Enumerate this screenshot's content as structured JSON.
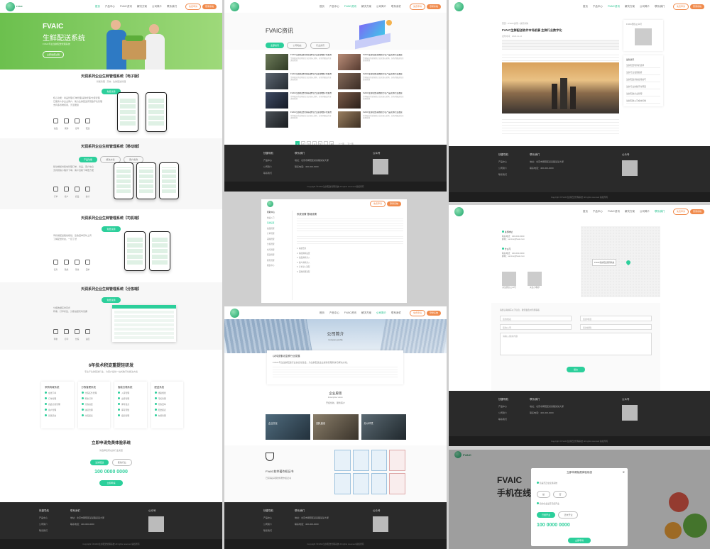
{
  "nav": {
    "brand": "FVAIC",
    "brand_sub": "生鲜配送",
    "links": [
      "首页",
      "产品中心",
      "FVAIC资讯",
      "解决方案",
      "公司简介",
      "联系我们"
    ],
    "apply": "免费申请",
    "login": "登录系统"
  },
  "p1": {
    "hero_title": "FVAIC",
    "hero_sub": "生鲜配送系统",
    "hero_desc": "FVAIC专业生鲜配送管理系统",
    "hero_btn": "立即免费试用",
    "sec1_title": "天润系列企业生鲜管理系统【电子版】",
    "sec1_sub": "智能管理 · 高效 · 生鲜配送管理",
    "sec1_btn": "免费试用",
    "sec1_text": [
      "核心功能：商品管理/订单管理/采购管理/分拣管理",
      "已服务众多企业客户，助力生鲜配送实现数字化管理",
      "支持多终端使用，灵活便捷"
    ],
    "sec1_icons": [
      "商品",
      "采购",
      "仓库",
      "配送"
    ],
    "sec2_title": "天润系列企业生鲜管理系统【移动端】",
    "sec2_tabs": [
      "产品功能",
      "解决方案",
      "客户案例"
    ],
    "sec2_text": [
      "移动端随时随地管理订单、商品、客户信息",
      "支持微信小程序下单，客户自助下单更方便"
    ],
    "sec2_icons": [
      "订单",
      "客户",
      "商品",
      "统计"
    ],
    "sec3_title": "天润系列企业生鲜管理系统【司机端】",
    "sec3_btn": "免费试用",
    "sec3_text": [
      "司机端配送路线规划，签收回单实时上传",
      "了解配送状态，一目了然"
    ],
    "sec3_icons": [
      "任务",
      "路线",
      "签收",
      "回单"
    ],
    "sec4_title": "天润系列企业生鲜管理系统【分拣端】",
    "sec4_btn": "免费试用",
    "sec4_text": [
      "分拣数据实时同步",
      "称重、打印标签、分拣进度实时掌握"
    ],
    "sec4_icons": [
      "称重",
      "打印",
      "分拣",
      "进度"
    ],
    "feature_title": "6年技术积淀重提轻研发",
    "feature_sub": "专注于生鲜配送行业，为客户提供一站式数字化解决方案",
    "feature_cards": [
      {
        "title": "采购商城系统",
        "items": [
          "在线下单",
          "订单管理",
          "商品分类管理",
          "客户管理",
          "营销活动"
        ]
      },
      {
        "title": "分拣管理系统",
        "items": [
          "分拣任务管理",
          "称重打印",
          "分拣进度",
          "缺货管理",
          "分拣报表"
        ]
      },
      {
        "title": "智能仓储系统",
        "items": [
          "入库管理",
          "出库管理",
          "库存盘点",
          "库存预警",
          "报损管理"
        ]
      },
      {
        "title": "配送系统",
        "items": [
          "线路规划",
          "司机管理",
          "签收回单",
          "配送报表",
          "车辆管理"
        ]
      }
    ],
    "apply_title": "立即申请免费体验系统",
    "apply_hint": "请选择您所在的行业类型",
    "apply_opts": [
      "生鲜配送",
      "其他行业"
    ],
    "phone": "100 0000 0000",
    "apply_btn": "立即申请"
  },
  "p2": {
    "title": "FVAIC资讯",
    "tabs": [
      "全部资讯",
      "公司动态",
      "行业资讯"
    ],
    "news": [
      "FVAIC生鲜配送管理系统为企业提供数字化服务",
      "FVAIC生鲜配送系统助力农产品流通行业发展",
      "FVAIC生鲜配送管理系统为企业提供数字化服务",
      "FVAIC生鲜配送系统助力农产品流通行业发展",
      "FVAIC生鲜配送管理系统为企业提供数字化服务",
      "FVAIC生鲜配送系统助力农产品流通行业发展",
      "FVAIC生鲜配送管理系统为企业提供数字化服务",
      "FVAIC生鲜配送系统助力农产品流通行业发展"
    ],
    "news_desc": "生鲜配送系统帮助企业实现从采购、分拣到配送的全流程管理",
    "pages": [
      "1",
      "2",
      "3",
      "4",
      "5",
      "...",
      "10"
    ],
    "prev": "上一页",
    "next": "下一页"
  },
  "p3": {
    "breadcrumb": [
      "首页",
      "FVAIC资讯",
      "资讯详情"
    ],
    "title": "FVAIC生鲜配送软件市场前景 生鲜行业数字化",
    "meta": "发布时间：2020-11-12",
    "side_title": "FVAIC微信公众号",
    "hot_title": "最新资讯",
    "hot": [
      "生鲜配送软件的选择",
      "生鲜行业发展趋势",
      "生鲜配送系统使用技巧",
      "生鲜行业的数字化转型",
      "生鲜配送企业管理",
      "生鲜配送公司成本控制"
    ]
  },
  "p4": {
    "menu_title": "帮助中心",
    "menu": [
      "快速入门",
      "基础设置",
      "商品管理",
      "订单管理",
      "采购管理",
      "分拣管理",
      "仓库管理",
      "配送管理",
      "财务管理",
      "报表中心"
    ],
    "title": "系统设置 基础设置",
    "steps": [
      "1. 系统登录",
      "2. 基础资料设置",
      "3. 商品资料录入",
      "4. 客户资料录入",
      "5. 订单录入流程",
      "6. 采购管理流程"
    ]
  },
  "p5": {
    "banner_title": "公司简介",
    "banner_sub": "Company profile",
    "card_title": "以科技推动生鲜行业发展",
    "card_text": "FVAIC专注生鲜配送行业信息化建设，为生鲜配送企业提供管理系统与解决方案。",
    "culture_title": "企业愿景",
    "culture_sub": "Enterprise vision",
    "culture_text": "开拓创新，服务客户",
    "photo_labels": [
      "企业文化",
      "团队建设",
      "办公环境"
    ],
    "cert_title": "FVAIC软件著作权证书",
    "cert_text": "已获得多项软件著作权证书"
  },
  "p6": {
    "contacts": [
      {
        "label": "总部地址",
        "line1": "联系电话：400-000-0000",
        "line2": "邮箱：service@fvaic.com"
      },
      {
        "label": "分公司",
        "line1": "联系电话：400-000-0000",
        "line2": "邮箱：service@fvaic.com"
      }
    ],
    "qr_labels": [
      "关注微信公众号",
      "关注小程序"
    ],
    "map_popup": "FVAIC生鲜配送管理系统",
    "form_hint": "请您认真填写以下信息，我们会及时与您联系",
    "fields": [
      "您的姓名",
      "您的电话",
      "您的公司",
      "您的邮箱"
    ],
    "message": "请输入留言内容",
    "submit": "提交"
  },
  "p7": {
    "hero_title": "FVAIC",
    "hero_sub": "手机在线",
    "modal_title": "立即申请免费体验系统",
    "q1": "您是否正在使用系统",
    "q1_opts": [
      "是",
      "否"
    ],
    "q2": "您的企业是否已经开业",
    "q2_opts": [
      "已经开业",
      "还未开业"
    ],
    "phone": "100 0000 0000",
    "close": "✕",
    "btn": "立即申请"
  },
  "footer": {
    "h1": "快捷导航",
    "h2": "联系我们",
    "h3": "公众号",
    "links": [
      "产品中心",
      "公司简介",
      "联系我们"
    ],
    "addr": "地址：北京市朝阳区某某路某某大厦",
    "tel": "联系电话：400-000-0000",
    "copy": "Copyright ©FVAIC生鲜配送管理系统 All rights reserved 版权所有"
  }
}
